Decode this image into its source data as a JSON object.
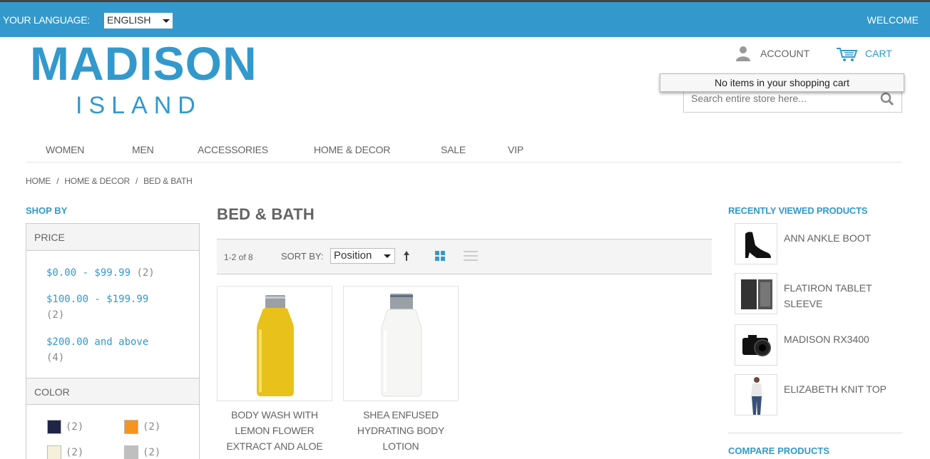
{
  "header": {
    "language_label": "YOUR LANGUAGE:",
    "language_value": "ENGLISH",
    "welcome": "WELCOME",
    "logo_main": "MADISON",
    "logo_sub": "ISLAND",
    "account_label": "ACCOUNT",
    "cart_label": "CART",
    "cart_popup": "No items in your shopping cart",
    "search_placeholder": "Search entire store here..."
  },
  "nav": {
    "items": [
      "WOMEN",
      "MEN",
      "ACCESSORIES",
      "HOME & DECOR",
      "SALE",
      "VIP"
    ]
  },
  "breadcrumb": [
    "HOME",
    "HOME & DECOR",
    "BED & BATH"
  ],
  "sidebar": {
    "title": "SHOP BY",
    "price_header": "PRICE",
    "prices": [
      {
        "label": "$0.00 - $99.99",
        "count": "(2)"
      },
      {
        "label": "$100.00 - $199.99",
        "count": "(2)"
      },
      {
        "label": "$200.00 and above",
        "count": "(4)"
      }
    ],
    "color_header": "COLOR",
    "colors": [
      {
        "color": "#1f2546",
        "count": "(2)"
      },
      {
        "color": "#f7941d",
        "count": "(2)"
      },
      {
        "color": "#f5f0dc",
        "count": "(2)"
      },
      {
        "color": "#bfbfbf",
        "count": "(2)"
      }
    ]
  },
  "main": {
    "category_title": "BED & BATH",
    "count_text": "1-2 of 8",
    "sort_label": "SORT BY:",
    "sort_value": "Position",
    "products": [
      {
        "name_lines": [
          "BODY WASH WITH",
          "LEMON FLOWER",
          "EXTRACT AND ALOE"
        ],
        "liquid": "#e8c21a"
      },
      {
        "name_lines": [
          "SHEA ENFUSED",
          "HYDRATING BODY",
          "LOTION"
        ],
        "liquid": "#f6f6f4"
      }
    ]
  },
  "right": {
    "recently_title": "RECENTLY VIEWED PRODUCTS",
    "recent_items": [
      "ANN ANKLE BOOT",
      "FLATIRON TABLET SLEEVE",
      "MADISON RX3400",
      "ELIZABETH KNIT TOP"
    ],
    "compare_title": "COMPARE PRODUCTS"
  },
  "colors": {
    "accent": "#3399cc",
    "text": "#636363"
  }
}
